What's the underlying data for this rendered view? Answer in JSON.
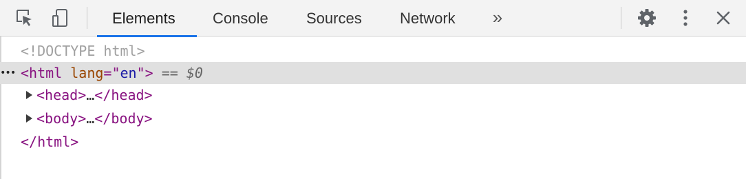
{
  "toolbar": {
    "icons": {
      "inspect": "inspect-element-icon",
      "device": "device-toolbar-icon",
      "settings": "gear-icon",
      "menu": "kebab-menu-icon",
      "close": "close-icon"
    },
    "tabs": [
      {
        "label": "Elements",
        "active": true
      },
      {
        "label": "Console",
        "active": false
      },
      {
        "label": "Sources",
        "active": false
      },
      {
        "label": "Network",
        "active": false
      }
    ],
    "more_tabs": "»",
    "accent_color": "#1a73e8"
  },
  "dom_tree": {
    "doctype": "<!DOCTYPE html>",
    "html_line": {
      "dots": "•••",
      "open": "<html ",
      "attr_name": "lang",
      "attr_eq": "=\"",
      "attr_value": "en",
      "attr_close": "\">",
      "selected_marker": " == ",
      "dollar_ref": "$0"
    },
    "children": [
      {
        "open": "<head>",
        "ellipsis": "…",
        "close": "</head>"
      },
      {
        "open": "<body>",
        "ellipsis": "…",
        "close": "</body>"
      }
    ],
    "html_close": "</html>"
  }
}
